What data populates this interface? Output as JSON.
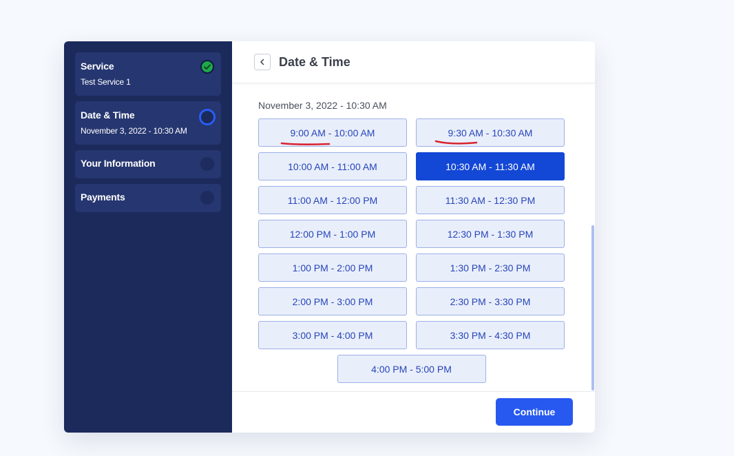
{
  "sidebar": {
    "steps": [
      {
        "title": "Service",
        "subtitle": "Test Service 1",
        "status": "completed"
      },
      {
        "title": "Date & Time",
        "subtitle": "November 3, 2022 - 10:30 AM",
        "status": "current"
      },
      {
        "title": "Your Information",
        "subtitle": "",
        "status": "pending"
      },
      {
        "title": "Payments",
        "subtitle": "",
        "status": "pending"
      }
    ]
  },
  "header": {
    "title": "Date & Time",
    "back_icon": "chevron-left-icon"
  },
  "content": {
    "selected_date": "November 3, 2022 - 10:30 AM",
    "time_slots": [
      "9:00 AM - 10:00 AM",
      "9:30 AM - 10:30 AM",
      "10:00 AM - 11:00 AM",
      "10:30 AM - 11:30 AM",
      "11:00 AM - 12:00 PM",
      "11:30 AM - 12:30 PM",
      "12:00 PM - 1:00 PM",
      "12:30 PM - 1:30 PM",
      "1:00 PM - 2:00 PM",
      "1:30 PM - 2:30 PM",
      "2:00 PM - 3:00 PM",
      "2:30 PM - 3:30 PM",
      "3:00 PM - 4:00 PM",
      "3:30 PM - 4:30 PM",
      "4:00 PM - 5:00 PM"
    ],
    "selected_slot": "10:30 AM - 11:30 AM"
  },
  "footer": {
    "continue_label": "Continue"
  },
  "colors": {
    "sidebar_bg": "#1b2a5b",
    "step_bg": "#263670",
    "accent": "#2759f0",
    "selected_slot": "#1347d6",
    "completed": "#1fa84a",
    "annotation": "#d9232e"
  }
}
